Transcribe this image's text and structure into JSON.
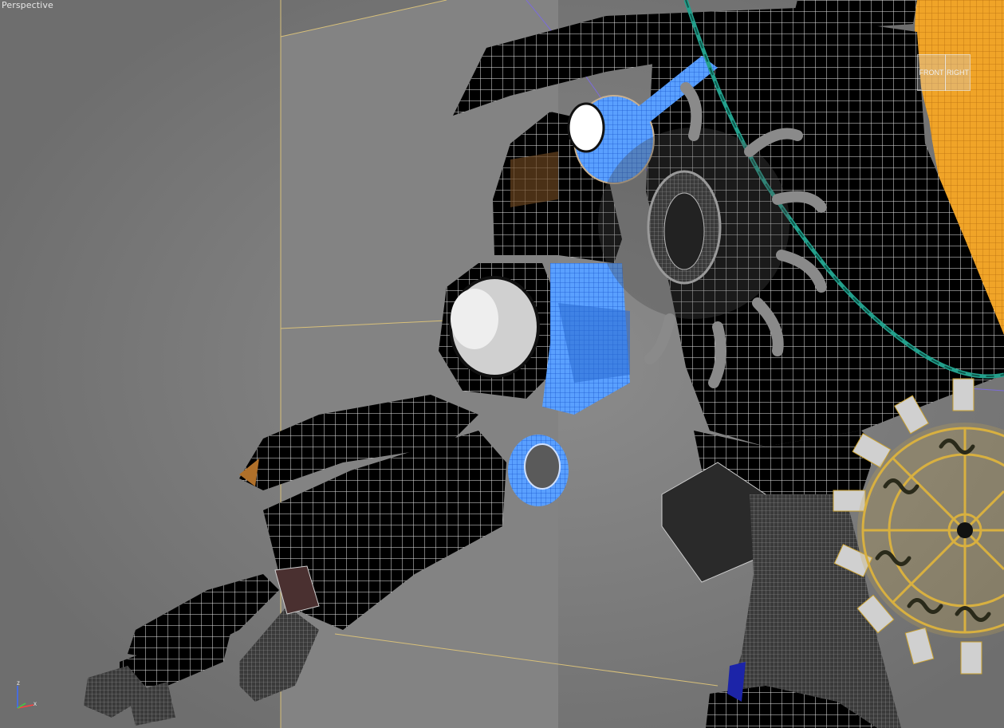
{
  "viewport": {
    "label": "Perspective"
  },
  "viewcube": {
    "front_label": "FRONT",
    "right_label": "RIGHT"
  },
  "axis_tripod": {
    "z_label": "z",
    "x_label": "x"
  },
  "colors": {
    "background": "#7a7a7a",
    "mesh_fill": "#000000",
    "wireframe": "#ffffff",
    "selection_blue": "#3c8cff",
    "chain_teal": "#1f8f7f",
    "gold": "#c8a030",
    "orange_skin": "#e8a030",
    "grid_line": "#c8b070"
  },
  "icons": [
    "viewcube-icon",
    "axis-tripod-icon"
  ]
}
